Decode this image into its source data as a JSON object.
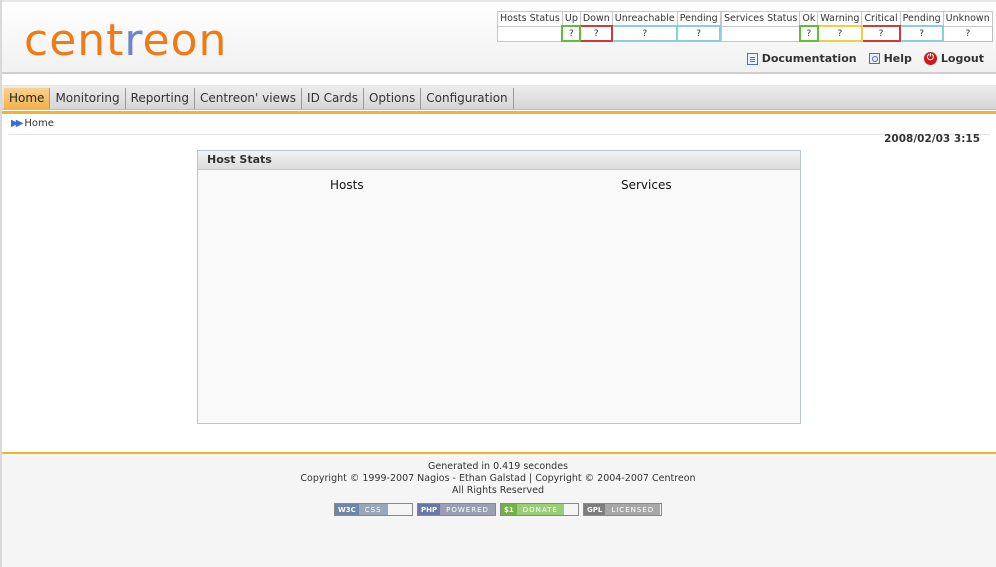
{
  "logo": {
    "before": "cent",
    "middle": "r",
    "after": "eon"
  },
  "hosts_status": {
    "headers": [
      "Hosts Status",
      "Up",
      "Down",
      "Unreachable",
      "Pending"
    ],
    "values": [
      "",
      "?",
      "?",
      "?",
      "?"
    ]
  },
  "services_status": {
    "headers": [
      "Services Status",
      "Ok",
      "Warning",
      "Critical",
      "Pending",
      "Unknown"
    ],
    "values": [
      "",
      "?",
      "?",
      "?",
      "?",
      "?"
    ]
  },
  "top_links": {
    "documentation": "Documentation",
    "help": "Help",
    "logout": "Logout"
  },
  "menu": [
    "Home",
    "Monitoring",
    "Reporting",
    "Centreon' views",
    "ID Cards",
    "Options",
    "Configuration"
  ],
  "breadcrumb": "Home",
  "datetime": "2008/02/03 3:15",
  "panel": {
    "title": "Host Stats",
    "hosts_label": "Hosts",
    "services_label": "Services"
  },
  "footer": {
    "generated": "Generated in 0.419 secondes",
    "copyright": "Copyright © 1999-2007 Nagios - Ethan Galstad | Copyright © 2004-2007 Centreon",
    "rights": "All Rights Reserved"
  },
  "badges": [
    {
      "left": "W3C",
      "right": "CSS",
      "lcolor": "#6f86a6",
      "rcolor": "#9aa7b8"
    },
    {
      "left": "PHP",
      "right": "POWERED",
      "lcolor": "#6a78a8",
      "rcolor": "#9aa0b4"
    },
    {
      "left": "$1",
      "right": "DONATE",
      "lcolor": "#74b04a",
      "rcolor": "#9acc78"
    },
    {
      "left": "GPL",
      "right": "LICENSED",
      "lcolor": "#7d7d7d",
      "rcolor": "#a7a7a7"
    }
  ]
}
